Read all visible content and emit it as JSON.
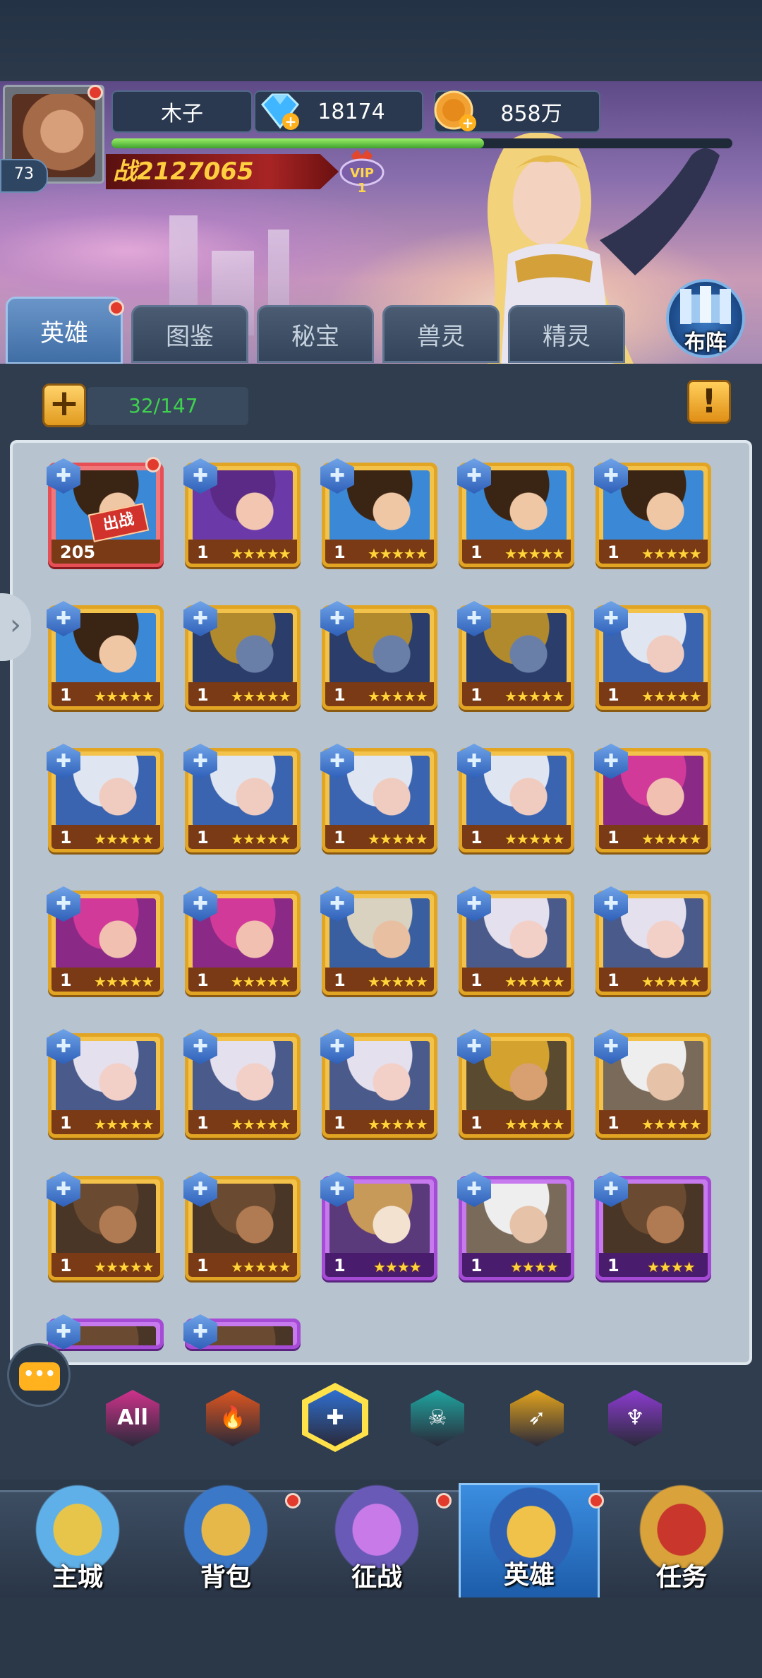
{
  "player": {
    "name": "木子",
    "level": "73",
    "gems": "18174",
    "gold": "858万",
    "power": "战2127065",
    "vip_label": "VIP",
    "vip_level": "1",
    "exp_fraction": 0.6
  },
  "tabs": [
    {
      "label": "英雄",
      "active": true
    },
    {
      "label": "图鉴",
      "active": false
    },
    {
      "label": "秘宝",
      "active": false
    },
    {
      "label": "兽灵",
      "active": false
    },
    {
      "label": "精灵",
      "active": false
    }
  ],
  "formation_label": "布阵",
  "hero_count": "32/147",
  "add_label": "+",
  "info_label": "!",
  "deployed_tag": "出战",
  "heroes": [
    {
      "level": "205",
      "rarity": "red",
      "portrait": "swordsman",
      "deployed": true,
      "stars": 0,
      "alert": true
    },
    {
      "level": "1",
      "rarity": "gold",
      "portrait": "goggle-girl",
      "stars": 5
    },
    {
      "level": "1",
      "rarity": "gold",
      "portrait": "swordsman",
      "stars": 5
    },
    {
      "level": "1",
      "rarity": "gold",
      "portrait": "swordsman",
      "stars": 5
    },
    {
      "level": "1",
      "rarity": "gold",
      "portrait": "swordsman",
      "stars": 5
    },
    {
      "level": "1",
      "rarity": "gold",
      "portrait": "swordsman",
      "stars": 5
    },
    {
      "level": "1",
      "rarity": "gold",
      "portrait": "armored-knight",
      "stars": 5
    },
    {
      "level": "1",
      "rarity": "gold",
      "portrait": "armored-knight",
      "stars": 5
    },
    {
      "level": "1",
      "rarity": "gold",
      "portrait": "armored-knight",
      "stars": 5
    },
    {
      "level": "1",
      "rarity": "gold",
      "portrait": "silver-hair",
      "stars": 5
    },
    {
      "level": "1",
      "rarity": "gold",
      "portrait": "silver-hair",
      "stars": 5
    },
    {
      "level": "1",
      "rarity": "gold",
      "portrait": "silver-hair",
      "stars": 5
    },
    {
      "level": "1",
      "rarity": "gold",
      "portrait": "silver-hair",
      "stars": 5
    },
    {
      "level": "1",
      "rarity": "gold",
      "portrait": "silver-hair",
      "stars": 5
    },
    {
      "level": "1",
      "rarity": "gold",
      "portrait": "magenta-hair",
      "stars": 5
    },
    {
      "level": "1",
      "rarity": "gold",
      "portrait": "magenta-hair",
      "stars": 5
    },
    {
      "level": "1",
      "rarity": "gold",
      "portrait": "magenta-hair",
      "stars": 5
    },
    {
      "level": "1",
      "rarity": "gold",
      "portrait": "old-king",
      "stars": 5
    },
    {
      "level": "1",
      "rarity": "gold",
      "portrait": "hooded-mage",
      "stars": 5
    },
    {
      "level": "1",
      "rarity": "gold",
      "portrait": "hooded-mage",
      "stars": 5
    },
    {
      "level": "1",
      "rarity": "gold",
      "portrait": "hooded-mage",
      "stars": 5
    },
    {
      "level": "1",
      "rarity": "gold",
      "portrait": "hooded-mage",
      "stars": 5
    },
    {
      "level": "1",
      "rarity": "gold",
      "portrait": "hooded-mage",
      "stars": 5
    },
    {
      "level": "1",
      "rarity": "gold",
      "portrait": "golden-helm",
      "stars": 5
    },
    {
      "level": "1",
      "rarity": "gold",
      "portrait": "monocle-elder",
      "stars": 5
    },
    {
      "level": "1",
      "rarity": "gold",
      "portrait": "brown-warrior",
      "stars": 5
    },
    {
      "level": "1",
      "rarity": "gold",
      "portrait": "brown-warrior",
      "stars": 5
    },
    {
      "level": "1",
      "rarity": "purple",
      "portrait": "white-masked",
      "stars": 4
    },
    {
      "level": "1",
      "rarity": "purple",
      "portrait": "monocle-elder",
      "stars": 4
    },
    {
      "level": "1",
      "rarity": "purple",
      "portrait": "brown-warrior",
      "stars": 4
    },
    {
      "level": "",
      "rarity": "purple",
      "portrait": "brown-warrior",
      "stars": 0,
      "partial": true
    },
    {
      "level": "",
      "rarity": "purple",
      "portrait": "brown-warrior",
      "stars": 0,
      "partial": true
    }
  ],
  "filters": [
    {
      "icon": "all-icon",
      "label": "All",
      "color": "#d0328c"
    },
    {
      "icon": "fire-faction-icon",
      "label": "🔥",
      "color": "#e0561f"
    },
    {
      "icon": "holy-faction-icon",
      "label": "✚",
      "color": "#2f6fd0",
      "active": true
    },
    {
      "icon": "skull-faction-icon",
      "label": "☠",
      "color": "#1fa6a0"
    },
    {
      "icon": "wing-faction-icon",
      "label": "➶",
      "color": "#e5a51c"
    },
    {
      "icon": "demon-faction-icon",
      "label": "♆",
      "color": "#8d3bd0"
    }
  ],
  "nav": [
    {
      "label": "主城",
      "icon": "castle-icon",
      "alert": false
    },
    {
      "label": "背包",
      "icon": "chest-icon",
      "alert": true
    },
    {
      "label": "征战",
      "icon": "portal-icon",
      "alert": true
    },
    {
      "label": "英雄",
      "icon": "helmet-icon",
      "alert": true,
      "active": true
    },
    {
      "label": "任务",
      "icon": "scroll-icon",
      "alert": false
    }
  ],
  "colors": {
    "gold_card": "#e2a423",
    "purple_card": "#a54bd6",
    "red_card": "#e64f55",
    "count_text": "#3ed24e",
    "power_text": "#ffcf3f"
  }
}
